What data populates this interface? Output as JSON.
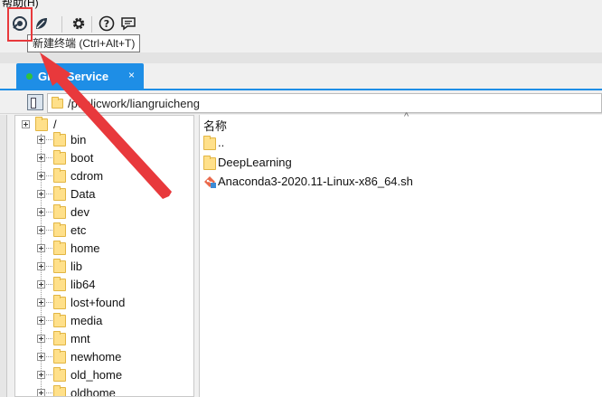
{
  "menubar": {
    "help_label": "帮助(H)"
  },
  "toolbar": {
    "tooltip": "新建终端 (Ctrl+Alt+T)",
    "buttons": [
      "terminal-icon",
      "leaf-icon",
      "gear-icon",
      "help-circle-icon",
      "chat-icon"
    ]
  },
  "tab": {
    "title": "GPU Service",
    "close": "×",
    "status_color": "#31c23c"
  },
  "path": {
    "value": "/publicwork/liangruicheng"
  },
  "tree": {
    "root": "/",
    "items": [
      "bin",
      "boot",
      "cdrom",
      "Data",
      "dev",
      "etc",
      "home",
      "lib",
      "lib64",
      "lost+found",
      "media",
      "mnt",
      "newhome",
      "old_home",
      "oldhome"
    ]
  },
  "filelist": {
    "column_name": "名称",
    "items": [
      {
        "name": "..",
        "type": "folder"
      },
      {
        "name": "DeepLearning",
        "type": "folder"
      },
      {
        "name": "Anaconda3-2020.11-Linux-x86_64.sh",
        "type": "script"
      }
    ]
  },
  "annotation": {
    "color": "#e8393c"
  },
  "colors": {
    "accent": "#1e8ee6",
    "folder": "#ffe08a"
  }
}
